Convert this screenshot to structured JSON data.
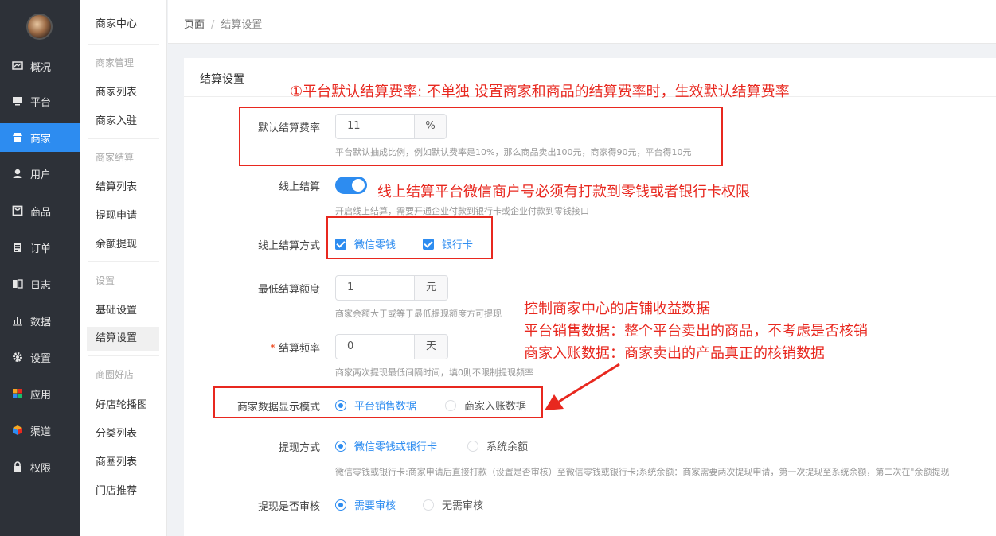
{
  "sidebar": {
    "items": [
      {
        "label": "概况",
        "icon": "chart-icon"
      },
      {
        "label": "平台",
        "icon": "monitor-icon"
      },
      {
        "label": "商家",
        "icon": "store-icon"
      },
      {
        "label": "用户",
        "icon": "user-icon"
      },
      {
        "label": "商品",
        "icon": "goods-icon"
      },
      {
        "label": "订单",
        "icon": "order-icon"
      },
      {
        "label": "日志",
        "icon": "log-icon"
      },
      {
        "label": "数据",
        "icon": "bar-chart-icon"
      },
      {
        "label": "设置",
        "icon": "gear-icon"
      },
      {
        "label": "应用",
        "icon": "apps-icon"
      },
      {
        "label": "渠道",
        "icon": "cube-icon"
      },
      {
        "label": "权限",
        "icon": "lock-icon"
      }
    ],
    "active_index": 2,
    "accent": "#2d8cf0"
  },
  "submenu": {
    "title": "商家中心",
    "groups": [
      {
        "label": "商家管理",
        "items": [
          "商家列表",
          "商家入驻"
        ]
      },
      {
        "label": "商家结算",
        "items": [
          "结算列表",
          "提现申请",
          "余额提现"
        ]
      },
      {
        "label": "设置",
        "items": [
          "基础设置",
          "结算设置"
        ]
      },
      {
        "label": "商圈好店",
        "items": [
          "好店轮播图",
          "分类列表",
          "商圈列表",
          "门店推荐"
        ]
      }
    ],
    "active": "结算设置"
  },
  "breadcrumb": {
    "root": "页面",
    "sep": "/",
    "current": "结算设置"
  },
  "form": {
    "title": "结算设置",
    "default_rate": {
      "label": "默认结算费率",
      "value": "11",
      "unit": "%",
      "help": "平台默认抽成比例，例如默认费率是10%，那么商品卖出100元，商家得90元，平台得10元"
    },
    "online": {
      "label": "线上结算",
      "enabled": true,
      "help": "开启线上结算，需要开通企业付款到银行卡或企业付款到零钱接口"
    },
    "online_method": {
      "label": "线上结算方式",
      "options": [
        "微信零钱",
        "银行卡"
      ],
      "checked": [
        true,
        true
      ]
    },
    "min_amount": {
      "label": "最低结算额度",
      "value": "1",
      "unit": "元",
      "help": "商家余额大于或等于最低提现额度方可提现"
    },
    "frequency": {
      "label": "结算频率",
      "required_mark": "*",
      "value": "0",
      "unit": "天",
      "help": "商家两次提现最低间隔时间，填0则不限制提现频率"
    },
    "display_mode": {
      "label": "商家数据显示模式",
      "options": [
        "平台销售数据",
        "商家入账数据"
      ],
      "selected": 0
    },
    "withdraw_method": {
      "label": "提现方式",
      "options": [
        "微信零钱或银行卡",
        "系统余额"
      ],
      "selected": 0,
      "help": "微信零钱或银行卡:商家申请后直接打款（设置是否审核）至微信零钱或银行卡;系统余额：商家需要两次提现申请，第一次提现至系统余额，第二次在\"余额提现"
    },
    "withdraw_review": {
      "label": "提现是否审核",
      "options": [
        "需要审核",
        "无需审核"
      ],
      "selected": 0
    }
  },
  "annotations": {
    "note1": "①平台默认结算费率: 不单独 设置商家和商品的结算费率时，生效默认结算费率",
    "note2": "线上结算平台微信商户号必须有打款到零钱或者银行卡权限",
    "note3_lines": [
      "控制商家中心的店铺收益数据",
      "平台销售数据：整个平台卖出的商品，不考虑是否核销",
      "商家入账数据：商家卖出的产品真正的核销数据"
    ],
    "color": "#e8281f"
  }
}
